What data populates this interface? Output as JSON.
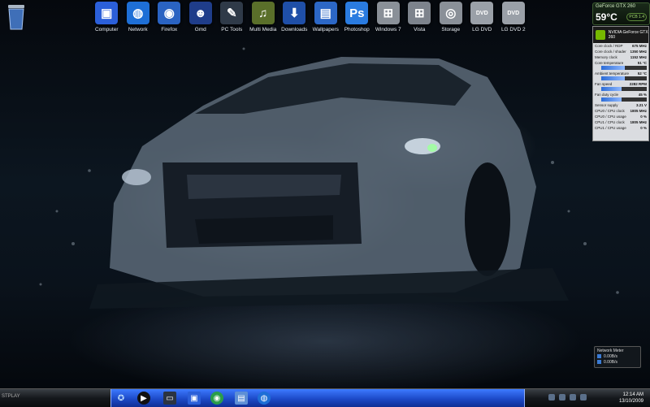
{
  "desktop": {
    "recycle_bin_icon": "recycle-bin-icon"
  },
  "dock": {
    "items": [
      {
        "label": "Computer",
        "icon": "monitor-icon",
        "color": "#2b5fd9",
        "glyph": "▣"
      },
      {
        "label": "Network",
        "icon": "globe-icon",
        "color": "#1e6fd6",
        "glyph": "◍"
      },
      {
        "label": "Firefox",
        "icon": "firefox-icon",
        "color": "#2a63c2",
        "glyph": "◉"
      },
      {
        "label": "Gmd",
        "icon": "user-icon",
        "color": "#1f3d8a",
        "glyph": "☻"
      },
      {
        "label": "PC Tools",
        "icon": "tools-icon",
        "color": "#2f3a48",
        "glyph": "✎"
      },
      {
        "label": "Multi Media",
        "icon": "media-icon",
        "color": "#5a6f2a",
        "glyph": "♫"
      },
      {
        "label": "Downloads",
        "icon": "download-icon",
        "color": "#1f4fa8",
        "glyph": "⬇"
      },
      {
        "label": "Wallpapers",
        "icon": "image-folder-icon",
        "color": "#2c67c6",
        "glyph": "▤"
      },
      {
        "label": "Photoshop",
        "icon": "photoshop-icon",
        "color": "#2a7be0",
        "glyph": "Ps"
      },
      {
        "label": "Windows 7",
        "icon": "windows-orb-icon",
        "color": "#8a9098",
        "glyph": "⊞"
      },
      {
        "label": "Vista",
        "icon": "vista-orb-icon",
        "color": "#7d838c",
        "glyph": "⊞"
      },
      {
        "label": "Storage",
        "icon": "storage-icon",
        "color": "#8a9098",
        "glyph": "◎"
      },
      {
        "label": "LG DVD",
        "icon": "dvd-icon",
        "color": "#9aa0a8",
        "glyph": "DVD"
      },
      {
        "label": "LG DVD 2",
        "icon": "dvd-icon",
        "color": "#9aa0a8",
        "glyph": "DVD"
      }
    ]
  },
  "gpu_widget": {
    "title": "GeForce GTX 260",
    "temperature": "59°C",
    "logo": "PCB 1.4"
  },
  "hardware_monitor": {
    "header": "NVIDIA GeForce GTX 260",
    "rows": [
      {
        "label": "Core clock / RDP",
        "value": "675 MHz"
      },
      {
        "label": "Core clock / shader",
        "value": "1350 MHz"
      },
      {
        "label": "Memory clock",
        "value": "1152 MHz"
      }
    ],
    "sensors": [
      {
        "label": "Core temperature",
        "value": "51 °C",
        "level": 0.51
      },
      {
        "label": "Ambient temperature",
        "value": "52 °C",
        "level": 0.52
      },
      {
        "label": "Fan speed",
        "value": "2282 RPM",
        "level": 0.45
      },
      {
        "label": "Fan duty cycle",
        "value": "45 %",
        "level": 0.45
      }
    ],
    "extra_rows": [
      {
        "label": "Sensor supply",
        "value": "3.21 V"
      },
      {
        "label": "CPU0 / CPU clock",
        "value": "1805 MHz"
      },
      {
        "label": "CPU0 / CPU usage",
        "value": "0 %"
      },
      {
        "label": "CPU1 / CPU clock",
        "value": "1805 MHz"
      },
      {
        "label": "CPU1 / CPU usage",
        "value": "0 %"
      }
    ]
  },
  "network_meter": {
    "title": "Network Meter",
    "down": "0.00B/s",
    "up": "0.00B/s"
  },
  "taskbar": {
    "left_text": "STPLAY",
    "time": "12:14 AM",
    "date": "13/10/2009"
  }
}
